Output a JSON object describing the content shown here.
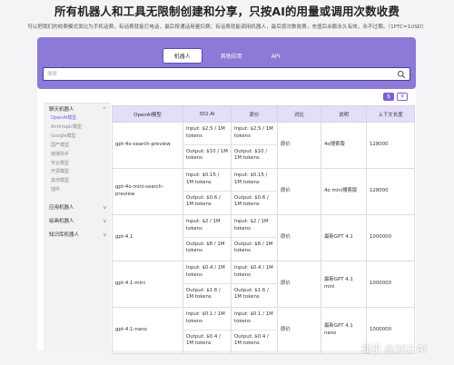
{
  "header": {
    "headline": "所有机器人和工具无限制创建和分享，只按AI的用量或调用次数收费",
    "subline": "可以把我们的收费模式类比为手机话费，有话费就能打电话，最后按通话用量扣费；有话费就能调用机器人，最后按次数收费，充值后余额永久有效，永不过期。（1PTC=1USD）"
  },
  "tabs": [
    {
      "label": "机器人",
      "active": true
    },
    {
      "label": "其他应用",
      "active": false
    },
    {
      "label": "API",
      "active": false
    }
  ],
  "search": {
    "placeholder": "搜索",
    "value": ""
  },
  "toggles": {
    "on_label": "$",
    "off_label": "¥"
  },
  "sidebar": {
    "groups": [
      {
        "label": "聊天机器人",
        "chevron": "^",
        "items": [
          {
            "label": "OpenAI模型",
            "active": true
          },
          {
            "label": "Anthropic模型",
            "active": false
          },
          {
            "label": "Google模型",
            "active": false
          },
          {
            "label": "国产模型",
            "active": false
          },
          {
            "label": "链接助手",
            "active": false
          },
          {
            "label": "专业模型",
            "active": false
          },
          {
            "label": "开源模型",
            "active": false
          },
          {
            "label": "其他模型",
            "active": false
          },
          {
            "label": "插件",
            "active": false
          }
        ]
      },
      {
        "label": "应用机器人",
        "chevron": "v",
        "items": []
      },
      {
        "label": "绘画机器人",
        "chevron": "v",
        "items": []
      },
      {
        "label": "知识库机器人",
        "chevron": "v",
        "items": []
      }
    ]
  },
  "table": {
    "headers": [
      "OpenAI模型",
      "302.AI",
      "原价",
      "对比",
      "说明",
      "上下文长度"
    ],
    "rows": [
      {
        "model": "gpt-4o-search-preview",
        "ai_in": "Input: $2.5 / 1M tokens",
        "ai_out": "Output: $10 / 1M tokens",
        "orig_in": "Input: $2.5 / 1M tokens",
        "orig_out": "Output: $10 / 1M tokens",
        "compare": "原价",
        "desc": "4o搜索版",
        "context": "128000"
      },
      {
        "model": "gpt-4o-mini-search-preview",
        "ai_in": "Input: $0.15 / 1M tokens",
        "ai_out": "Output: $0.6 / 1M tokens",
        "orig_in": "Input: $0.15 / 1M tokens",
        "orig_out": "Output: $0.6 / 1M tokens",
        "compare": "原价",
        "desc": "4o mini搜索版",
        "context": "128000"
      },
      {
        "model": "gpt-4.1",
        "ai_in": "Input: $2 / 1M tokens",
        "ai_out": "Output: $8 / 1M tokens",
        "orig_in": "Input: $2 / 1M tokens",
        "orig_out": "Output: $8 / 1M tokens",
        "compare": "原价",
        "desc": "最新GPT 4.1",
        "context": "1000000"
      },
      {
        "model": "gpt-4.1-mini",
        "ai_in": "Input: $0.4 / 1M tokens",
        "ai_out": "Output: $1.6 / 1M tokens",
        "orig_in": "Input: $0.4 / 1M tokens",
        "orig_out": "Output: $1.6 / 1M tokens",
        "compare": "原价",
        "desc": "最新GPT 4.1 mini",
        "context": "1000000"
      },
      {
        "model": "gpt-4.1-nano",
        "ai_in": "Input: $0.1 / 1M tokens",
        "ai_out": "Output: $0.4 / 1M tokens",
        "orig_in": "Input: $0.1 / 1M tokens",
        "orig_out": "Output: $0.4 / 1M tokens",
        "compare": "原价",
        "desc": "最新GPT 4.1 nano",
        "context": "1000000"
      }
    ]
  },
  "watermark": "知乎 @302 AI",
  "colors": {
    "accent": "#8d79d6",
    "header_row": "#e4def8",
    "active_item": "#7b61d9"
  }
}
